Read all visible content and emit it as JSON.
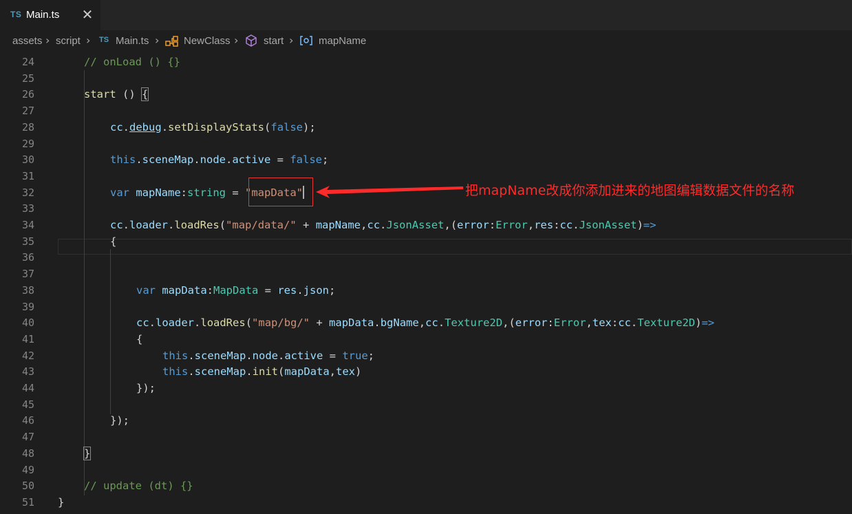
{
  "tab": {
    "icon": "TS",
    "title": "Main.ts",
    "close": "✕"
  },
  "breadcrumb": {
    "items": [
      {
        "label": "assets"
      },
      {
        "label": "script"
      },
      {
        "icon": "TS",
        "label": "Main.ts"
      },
      {
        "icon": "class-icon",
        "label": "NewClass"
      },
      {
        "icon": "method-icon",
        "label": "start"
      },
      {
        "icon": "field-icon",
        "label": "mapName"
      }
    ]
  },
  "editor": {
    "line_numbers": [
      "24",
      "25",
      "26",
      "27",
      "28",
      "29",
      "30",
      "31",
      "32",
      "33",
      "34",
      "35",
      "36",
      "37",
      "38",
      "39",
      "40",
      "41",
      "42",
      "43",
      "44",
      "45",
      "46",
      "47",
      "48",
      "49",
      "50",
      "51"
    ],
    "current_line": "32"
  },
  "annotation": {
    "text": "把mapName改成你添加进来的地图编辑数据文件的名称",
    "color": "#ff2b2b"
  },
  "colors": {
    "background": "#1e1e1e",
    "comment": "#6a9955",
    "keyword": "#569cd6",
    "variable": "#9cdcfe",
    "function": "#dcdcaa",
    "string": "#ce9178",
    "type": "#4ec9b0"
  },
  "code": {
    "l24": "// onLoad () {}",
    "l26_a": "start",
    "l26_b": " () ",
    "l26_c": "{",
    "l28_a": "cc",
    "l28_b": ".",
    "l28_c": "debug",
    "l28_d": ".",
    "l28_e": "setDisplayStats",
    "l28_f": "(",
    "l28_g": "false",
    "l28_h": ");",
    "l30_a": "this",
    "l30_b": ".",
    "l30_c": "sceneMap",
    "l30_d": ".",
    "l30_e": "node",
    "l30_f": ".",
    "l30_g": "active",
    "l30_h": " = ",
    "l30_i": "false",
    "l30_j": ";",
    "l32_a": "var",
    "l32_b": " ",
    "l32_c": "mapName",
    "l32_d": ":",
    "l32_e": "string",
    "l32_f": " = ",
    "l32_g": "\"mapData\"",
    "l34_a": "cc",
    "l34_b": ".",
    "l34_c": "loader",
    "l34_d": ".",
    "l34_e": "loadRes",
    "l34_f": "(",
    "l34_g": "\"map/data/\"",
    "l34_h": " + ",
    "l34_i": "mapName",
    "l34_j": ",",
    "l34_k": "cc",
    "l34_l": ".",
    "l34_m": "JsonAsset",
    "l34_n": ",(",
    "l34_o": "error",
    "l34_p": ":",
    "l34_q": "Error",
    "l34_r": ",",
    "l34_s": "res",
    "l34_t": ":",
    "l34_u": "cc",
    "l34_v": ".",
    "l34_w": "JsonAsset",
    "l34_x": ")",
    "l34_y": "=>",
    "l35": "{",
    "l38_a": "var",
    "l38_b": " ",
    "l38_c": "mapData",
    "l38_d": ":",
    "l38_e": "MapData",
    "l38_f": " = ",
    "l38_g": "res",
    "l38_h": ".",
    "l38_i": "json",
    "l38_j": ";",
    "l40_a": "cc",
    "l40_b": ".",
    "l40_c": "loader",
    "l40_d": ".",
    "l40_e": "loadRes",
    "l40_f": "(",
    "l40_g": "\"map/bg/\"",
    "l40_h": " + ",
    "l40_i": "mapData",
    "l40_j": ".",
    "l40_k": "bgName",
    "l40_l": ",",
    "l40_m": "cc",
    "l40_n": ".",
    "l40_o": "Texture2D",
    "l40_p": ",(",
    "l40_q": "error",
    "l40_r": ":",
    "l40_s": "Error",
    "l40_t": ",",
    "l40_u": "tex",
    "l40_v": ":",
    "l40_w": "cc",
    "l40_x": ".",
    "l40_y": "Texture2D",
    "l40_z": ")",
    "l40_zz": "=>",
    "l41": "{",
    "l42_a": "this",
    "l42_b": ".",
    "l42_c": "sceneMap",
    "l42_d": ".",
    "l42_e": "node",
    "l42_f": ".",
    "l42_g": "active",
    "l42_h": " = ",
    "l42_i": "true",
    "l42_j": ";",
    "l43_a": "this",
    "l43_b": ".",
    "l43_c": "sceneMap",
    "l43_d": ".",
    "l43_e": "init",
    "l43_f": "(",
    "l43_g": "mapData",
    "l43_h": ",",
    "l43_i": "tex",
    "l43_j": ")",
    "l44": "});",
    "l46": "});",
    "l48": "}",
    "l50": "// update (dt) {}",
    "l51": "}"
  }
}
